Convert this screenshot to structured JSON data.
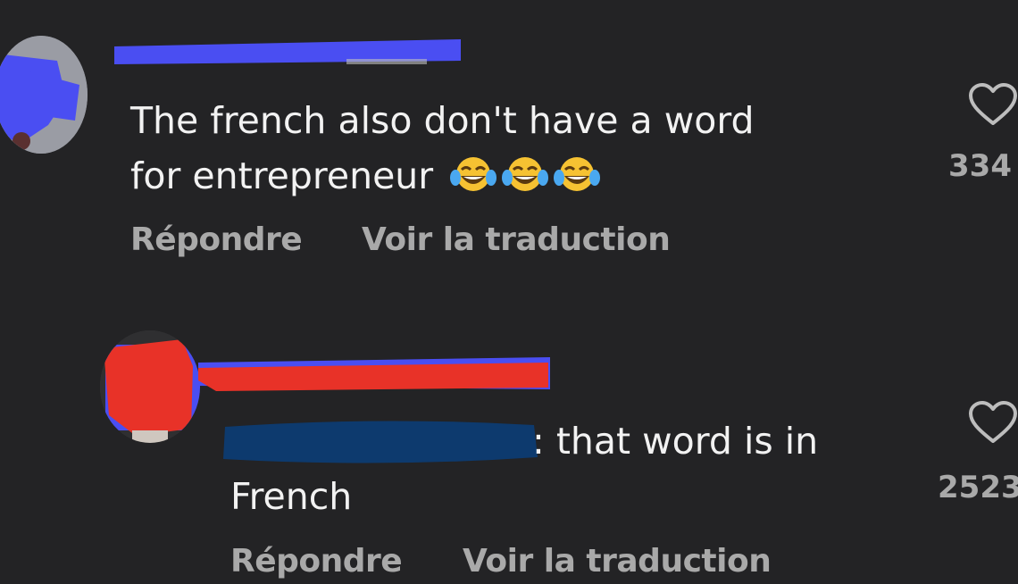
{
  "comments": [
    {
      "text_line1": "The french also don't have a word",
      "text_line2": "for entrepreneur",
      "emoji": [
        "face-with-tears-of-joy",
        "face-with-tears-of-joy",
        "face-with-tears-of-joy"
      ],
      "reply_label": "Répondre",
      "translate_label": "Voir la traduction",
      "like_count": "334",
      "like_icon": "heart-outline-icon"
    },
    {
      "text_line1": ": that word is in",
      "text_line2": "French",
      "reply_label": "Répondre",
      "translate_label": "Voir la traduction",
      "like_count": "2523",
      "like_icon": "heart-outline-icon"
    }
  ],
  "colors": {
    "background": "#232325",
    "text": "#f2f2f2",
    "muted": "#a9a9a9",
    "redaction_blue": "#4a4ef2",
    "redaction_red": "#e83228",
    "redaction_navy": "#0d3a6e"
  }
}
